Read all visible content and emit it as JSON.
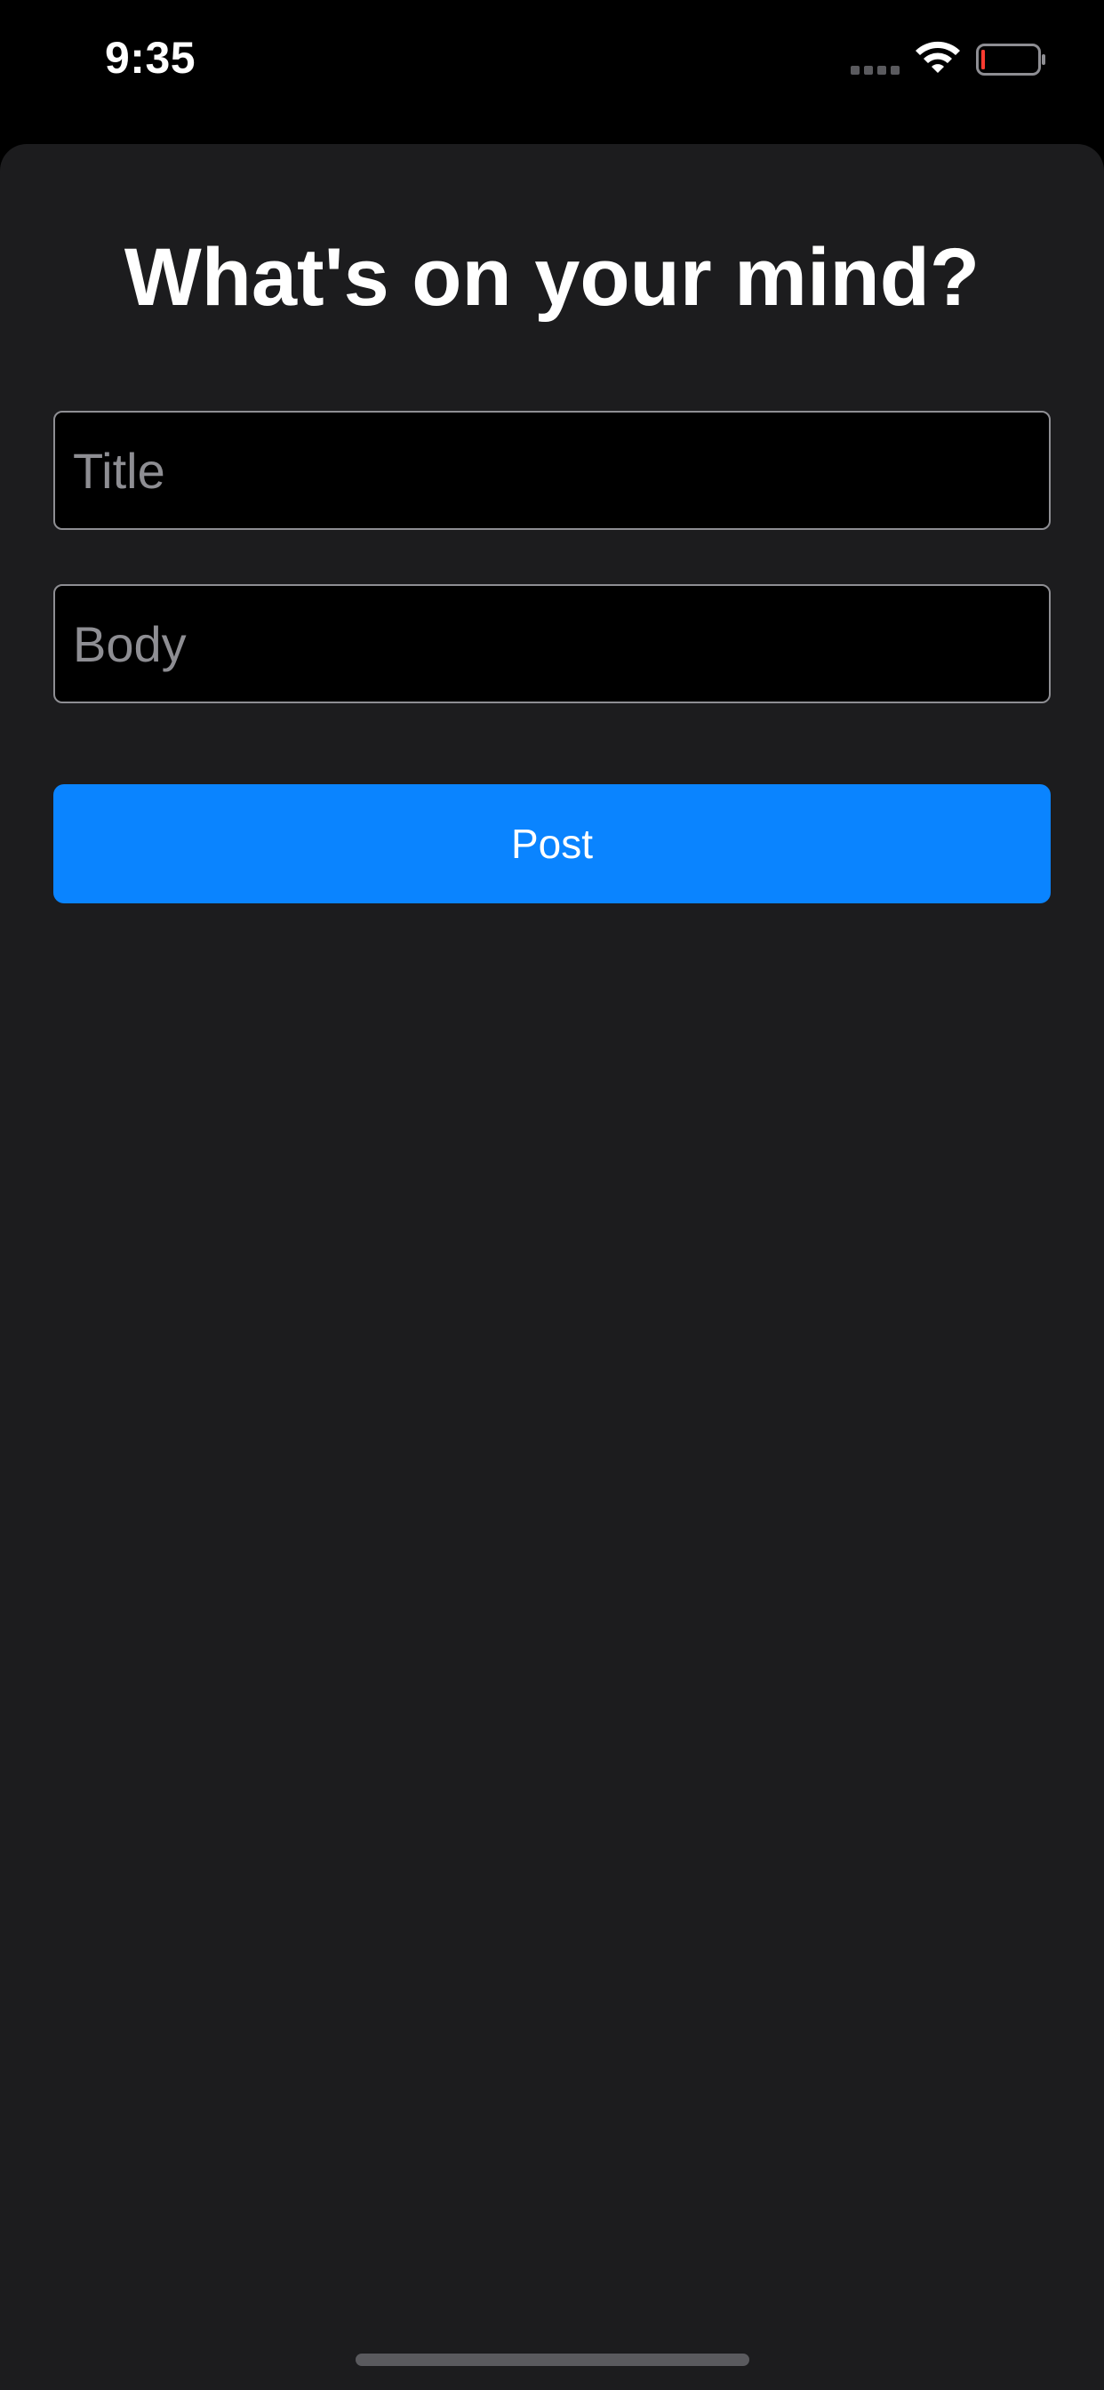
{
  "status_bar": {
    "time": "9:35",
    "signal_icon": "cellular-signal-icon",
    "wifi_icon": "wifi-icon",
    "battery_icon": "battery-low-icon"
  },
  "compose": {
    "heading": "What's on your mind?",
    "title_field": {
      "value": "",
      "placeholder": "Title"
    },
    "body_field": {
      "value": "",
      "placeholder": "Body"
    },
    "post_label": "Post"
  },
  "colors": {
    "accent": "#0a84ff",
    "sheet_background": "#1c1c1e",
    "battery_low": "#ff3b30"
  }
}
